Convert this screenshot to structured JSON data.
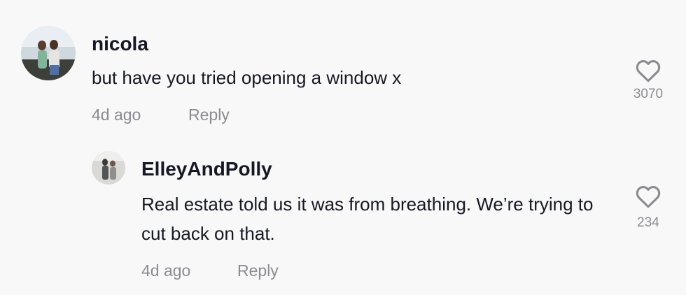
{
  "comment": {
    "username": "nicola",
    "text": "but have you tried opening a window x",
    "time": "4d ago",
    "reply_label": "Reply",
    "likes": "3070",
    "avatar_icon": "user-avatar-photo"
  },
  "reply": {
    "username": "ElleyAndPolly",
    "text": "Real estate told us it was from breathing. We’re trying to cut back on that.",
    "time": "4d ago",
    "reply_label": "Reply",
    "likes": "234",
    "avatar_icon": "user-avatar-photo"
  },
  "icons": {
    "like": "heart-outline-icon"
  },
  "colors": {
    "background": "#f8f8f8",
    "primary_text": "#161823",
    "secondary_text": "#8a8b91"
  }
}
